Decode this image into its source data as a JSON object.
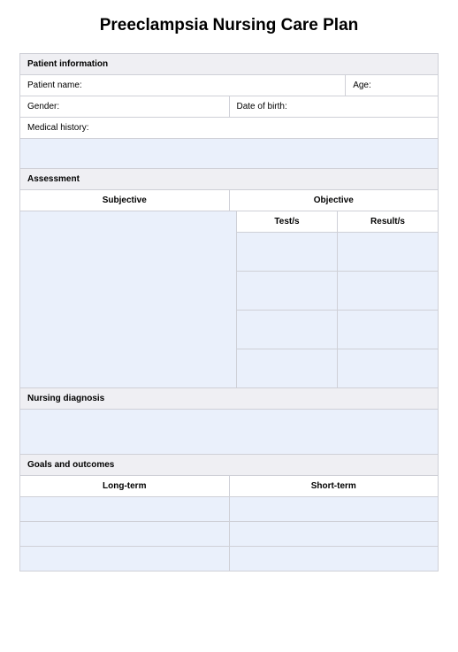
{
  "title": "Preeclampsia Nursing Care Plan",
  "patientInfo": {
    "header": "Patient information",
    "name_label": "Patient name:",
    "age_label": "Age:",
    "gender_label": "Gender:",
    "dob_label": "Date of birth:",
    "history_label": "Medical history:"
  },
  "assessment": {
    "header": "Assessment",
    "subjective_label": "Subjective",
    "objective_label": "Objective",
    "tests_label": "Test/s",
    "results_label": "Result/s"
  },
  "diagnosis": {
    "header": "Nursing diagnosis"
  },
  "goals": {
    "header": "Goals and outcomes",
    "longterm_label": "Long-term",
    "shortterm_label": "Short-term"
  }
}
